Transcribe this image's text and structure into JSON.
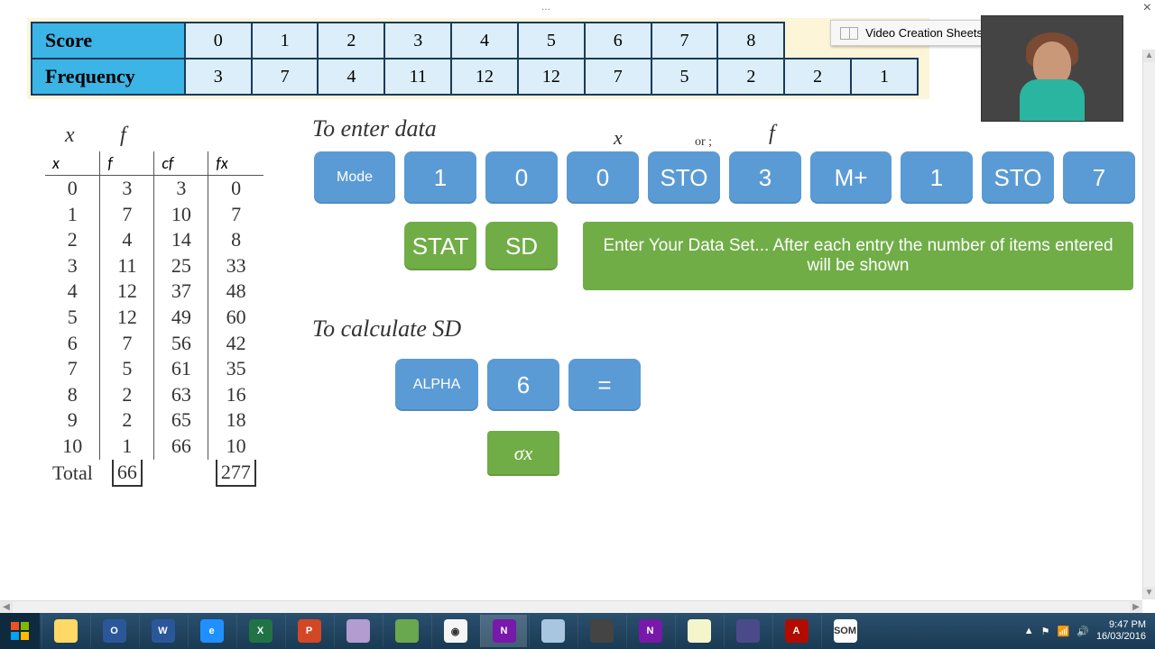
{
  "window": {
    "ellipsis": "...",
    "close": "×"
  },
  "popup": {
    "title": "Video Creation Sheets"
  },
  "score_table": {
    "row1_label": "Score",
    "row2_label": "Frequency",
    "scores": [
      "0",
      "1",
      "2",
      "3",
      "4",
      "5",
      "6",
      "7",
      "8"
    ],
    "freqs": [
      "3",
      "7",
      "4",
      "11",
      "12",
      "12",
      "7",
      "5",
      "2",
      "2",
      "1"
    ]
  },
  "hw_labels": {
    "x1": "x",
    "f1": "f",
    "x2": "x",
    "f2": "f",
    "arrow": "or ;",
    "enter": "To enter data",
    "sd": "To calculate SD"
  },
  "data_headers": {
    "x": "x",
    "f": "f",
    "cf": "cf",
    "fx": "fx"
  },
  "data_rows": [
    {
      "x": "0",
      "f": "3",
      "cf": "3",
      "fx": "0"
    },
    {
      "x": "1",
      "f": "7",
      "cf": "10",
      "fx": "7"
    },
    {
      "x": "2",
      "f": "4",
      "cf": "14",
      "fx": "8"
    },
    {
      "x": "3",
      "f": "11",
      "cf": "25",
      "fx": "33"
    },
    {
      "x": "4",
      "f": "12",
      "cf": "37",
      "fx": "48"
    },
    {
      "x": "5",
      "f": "12",
      "cf": "49",
      "fx": "60"
    },
    {
      "x": "6",
      "f": "7",
      "cf": "56",
      "fx": "42"
    },
    {
      "x": "7",
      "f": "5",
      "cf": "61",
      "fx": "35"
    },
    {
      "x": "8",
      "f": "2",
      "cf": "63",
      "fx": "16"
    },
    {
      "x": "9",
      "f": "2",
      "cf": "65",
      "fx": "18"
    },
    {
      "x": "10",
      "f": "1",
      "cf": "66",
      "fx": "10"
    }
  ],
  "totals": {
    "label": "Total",
    "f": "66",
    "fx": "277"
  },
  "buttons": {
    "mode": "Mode",
    "b1": "1",
    "b0a": "0",
    "b0b": "0",
    "sto": "STO",
    "b3": "3",
    "mplus": "M+",
    "b1b": "1",
    "sto2": "STO",
    "b7": "7",
    "stat": "STAT",
    "sd": "SD",
    "info": "Enter Your Data Set... After each entry the number of items entered will be shown",
    "alpha": "ALPHA",
    "b6": "6",
    "eq": "=",
    "sigma": "σx"
  },
  "taskbar": {
    "items": [
      {
        "name": "file-explorer",
        "bg": "#ffd966",
        "txt": ""
      },
      {
        "name": "outlook",
        "bg": "#2b579a",
        "txt": "O"
      },
      {
        "name": "word",
        "bg": "#2b579a",
        "txt": "W"
      },
      {
        "name": "ie",
        "bg": "#1e90ff",
        "txt": "e"
      },
      {
        "name": "excel",
        "bg": "#217346",
        "txt": "X"
      },
      {
        "name": "powerpoint",
        "bg": "#d24726",
        "txt": "P"
      },
      {
        "name": "app1",
        "bg": "#b39cd0",
        "txt": ""
      },
      {
        "name": "app2",
        "bg": "#6aa84f",
        "txt": ""
      },
      {
        "name": "chrome",
        "bg": "#f5f5f5",
        "txt": "◉"
      },
      {
        "name": "onenote",
        "bg": "#7719aa",
        "txt": "N",
        "active": true
      },
      {
        "name": "calc",
        "bg": "#a8c6e0",
        "txt": ""
      },
      {
        "name": "app3",
        "bg": "#444",
        "txt": ""
      },
      {
        "name": "onenote2",
        "bg": "#7719aa",
        "txt": "N"
      },
      {
        "name": "notepad",
        "bg": "#f5f5cc",
        "txt": ""
      },
      {
        "name": "app4",
        "bg": "#4a4a8a",
        "txt": ""
      },
      {
        "name": "adobe",
        "bg": "#b30b00",
        "txt": "A"
      },
      {
        "name": "som",
        "bg": "#fff",
        "txt": "SOM"
      }
    ],
    "time": "9:47 PM",
    "date": "16/03/2016"
  }
}
